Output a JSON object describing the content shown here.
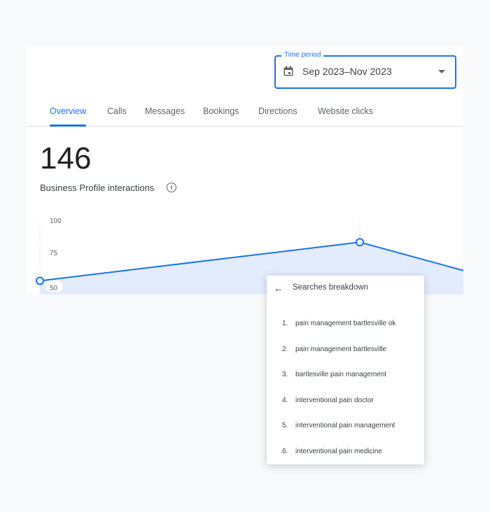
{
  "time_period": {
    "label": "Time period",
    "value": "Sep 2023–Nov 2023",
    "icon": "calendar-icon"
  },
  "tabs": [
    {
      "label": "Overview",
      "active": true
    },
    {
      "label": "Calls"
    },
    {
      "label": "Messages"
    },
    {
      "label": "Bookings"
    },
    {
      "label": "Directions"
    },
    {
      "label": "Website clicks"
    }
  ],
  "summary": {
    "value": "146",
    "label": "Business Profile interactions",
    "info_icon": "info-icon"
  },
  "chart_data": {
    "type": "area",
    "y_ticks": [
      "100",
      "75",
      "50"
    ],
    "ylim": [
      50,
      100
    ],
    "values": [
      53,
      83,
      61
    ],
    "color": "#1a73e8",
    "fill": "#e3ecfd"
  },
  "popup": {
    "title": "Searches breakdown",
    "back_icon": "arrow-left-icon",
    "items": [
      {
        "n": "1.",
        "text": "pain management bartlesville ok"
      },
      {
        "n": "2.",
        "text": "pain management bartlesville"
      },
      {
        "n": "3.",
        "text": "bartlesville pain management"
      },
      {
        "n": "4.",
        "text": "interventional pain doctor"
      },
      {
        "n": "5.",
        "text": "interventional pain management"
      },
      {
        "n": "6.",
        "text": "interventional pain medicine"
      }
    ]
  }
}
